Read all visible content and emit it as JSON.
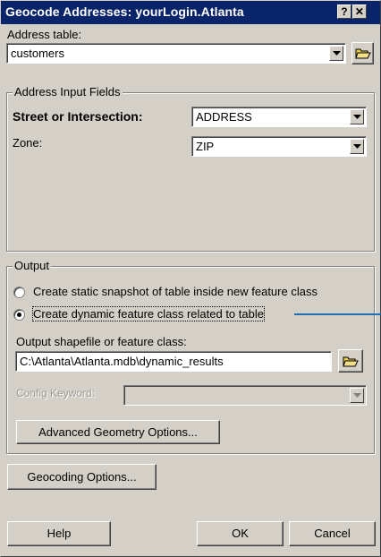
{
  "window": {
    "title": "Geocode Addresses: yourLogin.Atlanta",
    "help_glyph": "?",
    "close_glyph": "✕"
  },
  "address_table": {
    "label": "Address table:",
    "value": "customers"
  },
  "address_input": {
    "group_label": "Address Input Fields",
    "street_label": "Street or Intersection:",
    "street_value": "ADDRESS",
    "zone_label": "Zone:",
    "zone_value": "ZIP"
  },
  "output": {
    "group_label": "Output",
    "radio_static_label": "Create static snapshot of table inside new feature class",
    "radio_dynamic_label": "Create dynamic feature class related to table",
    "selected": "dynamic",
    "output_label": "Output shapefile or feature class:",
    "output_value": "C:\\Atlanta\\Atlanta.mdb\\dynamic_results",
    "config_label": "Config Keyword:",
    "config_value": "",
    "advanced_button": "Advanced Geometry Options..."
  },
  "geocoding_button": "Geocoding Options...",
  "footer": {
    "help": "Help",
    "ok": "OK",
    "cancel": "Cancel"
  },
  "icons": [
    "open-folder-icon",
    "dropdown-arrow-icon",
    "help-icon",
    "close-icon"
  ],
  "colors": {
    "titlebar": "#0a246a",
    "dialog_face": "#d4d0c8",
    "callout_line": "#1f6fb5"
  }
}
